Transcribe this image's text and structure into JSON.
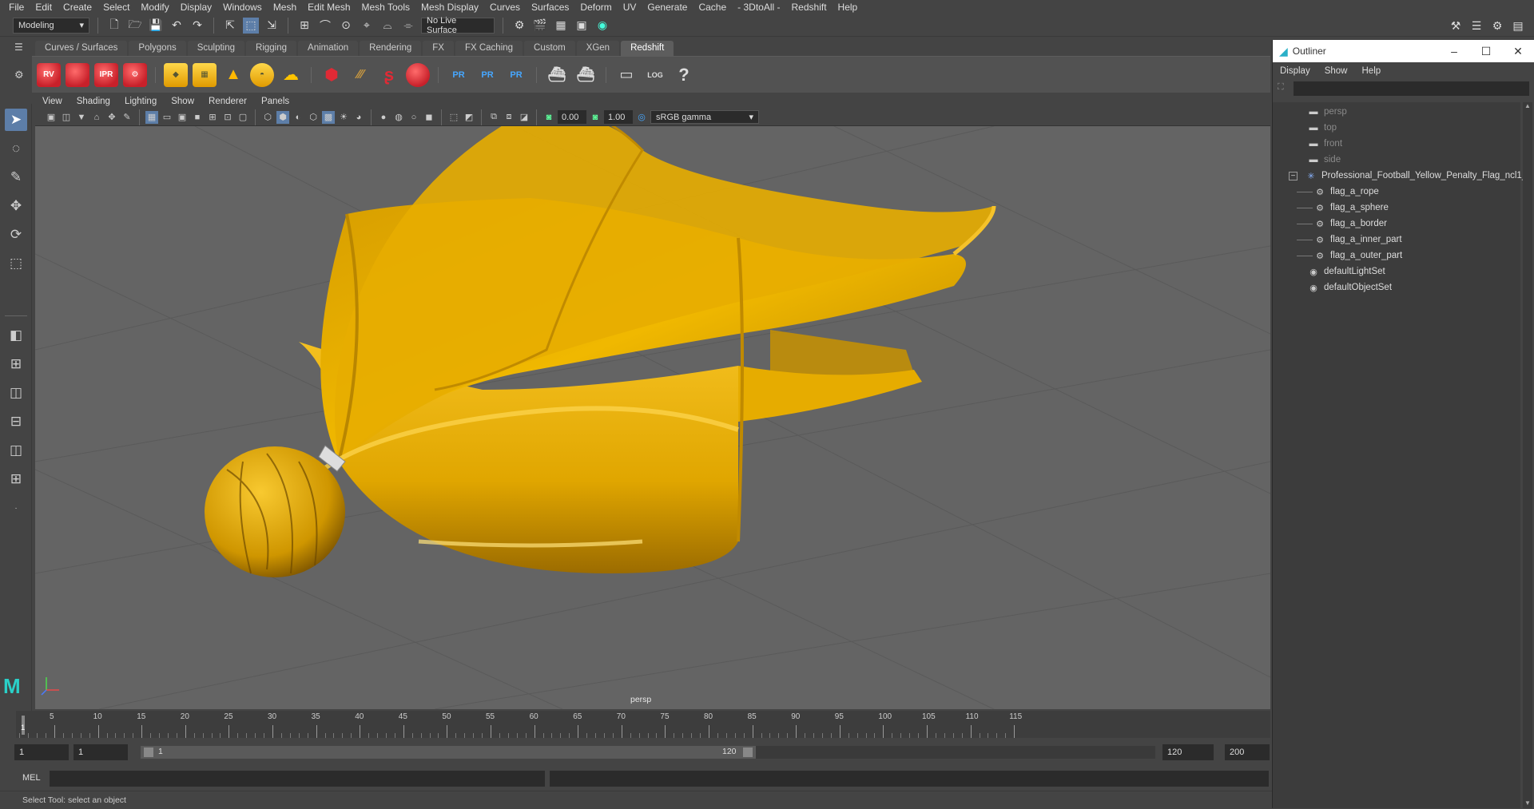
{
  "menubar": {
    "items": [
      "File",
      "Edit",
      "Create",
      "Select",
      "Modify",
      "Display",
      "Windows",
      "Mesh",
      "Edit Mesh",
      "Mesh Tools",
      "Mesh Display",
      "Curves",
      "Surfaces",
      "Deform",
      "UV",
      "Generate",
      "Cache",
      "- 3DtoAll -",
      "Redshift",
      "Help"
    ]
  },
  "statusline": {
    "mode": "Modeling",
    "live_surface": "No Live Surface"
  },
  "shelf": {
    "tabs": [
      "Curves / Surfaces",
      "Polygons",
      "Sculpting",
      "Rigging",
      "Animation",
      "Rendering",
      "FX",
      "FX Caching",
      "Custom",
      "XGen",
      "Redshift"
    ],
    "active_tab": "Redshift",
    "icon_labels": {
      "rv": "RV",
      "ipr": "IPR",
      "pr": "PR",
      "log": "LOG",
      "help": "?"
    }
  },
  "viewport": {
    "menu": [
      "View",
      "Shading",
      "Lighting",
      "Show",
      "Renderer",
      "Panels"
    ],
    "exposure": "0.00",
    "gamma": "1.00",
    "colorspace": "sRGB gamma",
    "camera_label": "persp"
  },
  "timeline": {
    "ticks": [
      "5",
      "10",
      "15",
      "20",
      "25",
      "30",
      "35",
      "40",
      "45",
      "50",
      "55",
      "60",
      "65",
      "70",
      "75",
      "80",
      "85",
      "90",
      "95",
      "100",
      "105",
      "110",
      "115"
    ],
    "current_frame": "1"
  },
  "range": {
    "start": "1",
    "start2": "1",
    "slider_start": "1",
    "slider_end": "120",
    "end": "120",
    "end2": "200"
  },
  "cmdline": {
    "label": "MEL"
  },
  "helpline": {
    "text": "Select Tool: select an object"
  },
  "outliner": {
    "title": "Outliner",
    "menu": [
      "Display",
      "Show",
      "Help"
    ],
    "cameras": [
      "persp",
      "top",
      "front",
      "side"
    ],
    "group": "Professional_Football_Yellow_Penalty_Flag_ncl1_",
    "children": [
      "flag_a_rope",
      "flag_a_sphere",
      "flag_a_border",
      "flag_a_inner_part",
      "flag_a_outer_part"
    ],
    "sets": [
      "defaultLightSet",
      "defaultObjectSet"
    ]
  },
  "colors": {
    "flag": "#e0a800",
    "viewport_bg": "#646464",
    "accent": "#5d7ea8"
  }
}
